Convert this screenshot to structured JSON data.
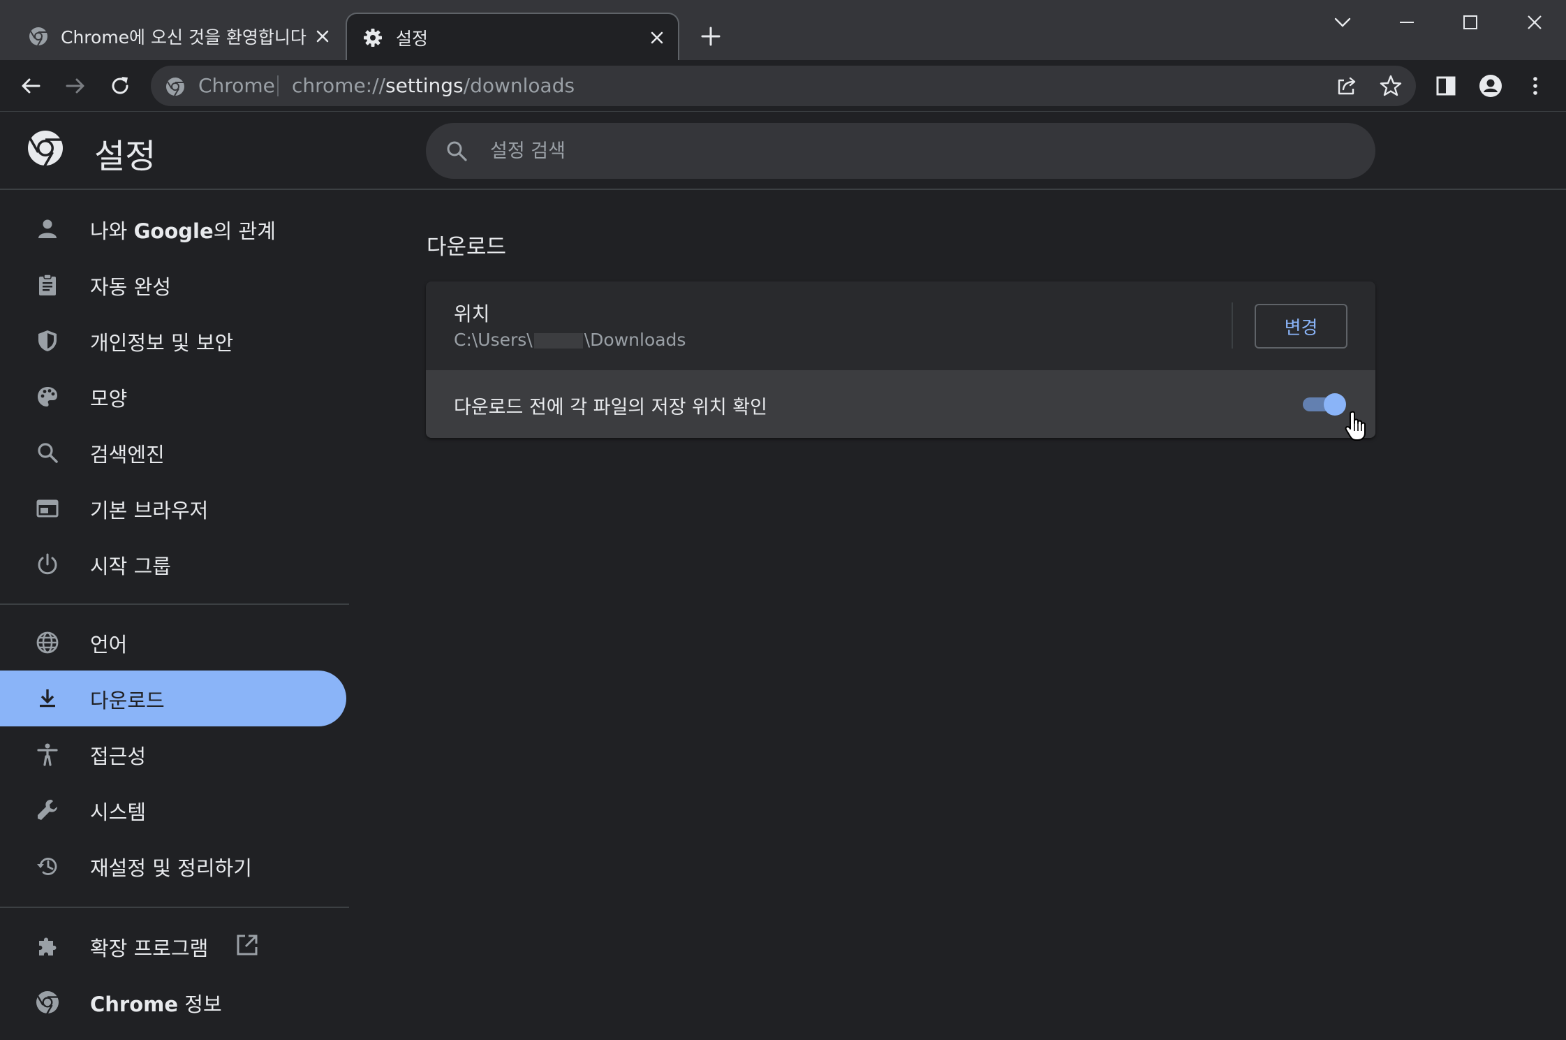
{
  "tabs": [
    {
      "title": "Chrome에 오신 것을 환영합니다",
      "icon": "chrome-icon",
      "active": false
    },
    {
      "title": "설정",
      "icon": "gear-icon",
      "active": true
    }
  ],
  "omnibox": {
    "origin_chip": "Chrome",
    "scheme": "chrome://",
    "host": "settings",
    "path": "/downloads"
  },
  "header": {
    "title": "설정",
    "search_placeholder": "설정 검색"
  },
  "sidebar": {
    "items": [
      {
        "label_main": "나와 ",
        "label_bold": "Google",
        "label_rest": "의 관계",
        "icon": "person-icon"
      },
      {
        "label": "자동 완성",
        "icon": "clipboard-icon"
      },
      {
        "label": "개인정보 및 보안",
        "icon": "shield-icon"
      },
      {
        "label": "모양",
        "icon": "palette-icon"
      },
      {
        "label": "검색엔진",
        "icon": "search-icon"
      },
      {
        "label": "기본 브라우저",
        "icon": "browser-icon"
      },
      {
        "label": "시작 그룹",
        "icon": "power-icon"
      },
      {
        "label": "언어",
        "icon": "globe-icon"
      },
      {
        "label": "다운로드",
        "icon": "download-icon",
        "active": true
      },
      {
        "label": "접근성",
        "icon": "accessibility-icon"
      },
      {
        "label": "시스템",
        "icon": "wrench-icon"
      },
      {
        "label": "재설정 및 정리하기",
        "icon": "history-icon"
      },
      {
        "label": "확장 프로그램",
        "icon": "puzzle-icon"
      },
      {
        "label_bold": "Chrome",
        "label_rest": " 정보",
        "icon": "chrome-icon"
      }
    ]
  },
  "main": {
    "section_title": "다운로드",
    "location_label": "위치",
    "location_path_prefix": "C:\\Users\\",
    "location_path_suffix": "\\Downloads",
    "change_button": "변경",
    "ask_label": "다운로드 전에 각 파일의 저장 위치 확인",
    "ask_enabled": true
  },
  "colors": {
    "accent": "#8ab4f8",
    "background": "#202124",
    "surface": "#292a2d"
  }
}
